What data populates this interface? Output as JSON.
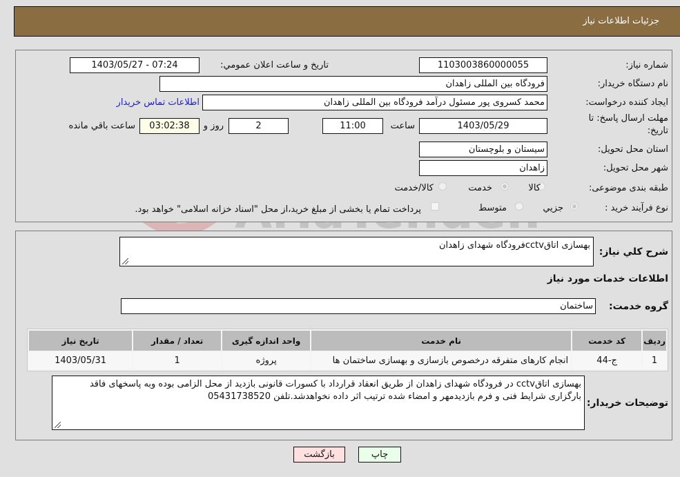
{
  "header": {
    "title": "جزئیات اطلاعات نیاز"
  },
  "info": {
    "need_number_label": "شماره نیاز:",
    "need_number": "1103003860000055",
    "announce_label": "تاريخ و ساعت اعلان عمومي:",
    "announce_value": "1403/05/27 - 07:24",
    "buyer_org_label": "نام دستگاه خریدار:",
    "buyer_org": "فرودگاه بین المللی زاهدان",
    "creator_label": "ایجاد کننده درخواست:",
    "creator": "محمد کسروی پور مسئول درآمد فرودگاه بین المللی زاهدان",
    "contact_link": "اطلاعات تماس خریدار",
    "deadline_label": "مهلت ارسال پاسخ: تا تاریخ:",
    "deadline_date": "1403/05/29",
    "time_label": "ساعت",
    "deadline_time": "11:00",
    "days_value": "2",
    "days_label": "روز و",
    "remaining_time": "03:02:38",
    "remaining_label": "ساعت باقي مانده",
    "province_label": "استان محل تحویل:",
    "province": "سیستان و بلوچستان",
    "city_label": "شهر محل تحویل:",
    "city": "زاهدان",
    "category_label": "طبقه بندی موضوعی:",
    "category_options": [
      {
        "label": "کالا",
        "selected": false
      },
      {
        "label": "خدمت",
        "selected": true
      },
      {
        "label": "کالا/خدمت",
        "selected": false
      }
    ],
    "process_label": "نوع فرآیند خرید :",
    "process_options": [
      {
        "label": "جزيي",
        "selected": true
      },
      {
        "label": "متوسط",
        "selected": false
      }
    ],
    "treasury_checkbox_label": "پرداخت تمام یا بخشی از مبلغ خرید،از محل \"اسناد خزانه اسلامی\" خواهد بود.",
    "treasury_checked": false
  },
  "details": {
    "summary_label": "شرح کلي نياز:",
    "summary": "بهسازی اتاقcctvفرودگاه شهدای زاهدان",
    "services_heading": "اطلاعات خدمات مورد نیاز",
    "service_group_label": "گروه خدمت:",
    "service_group": "ساختمان",
    "table": {
      "headers": [
        "ردیف",
        "کد خدمت",
        "نام خدمت",
        "واحد اندازه گیری",
        "تعداد / مقدار",
        "تاریخ نیاز"
      ],
      "rows": [
        [
          "1",
          "ج-44",
          "انجام کارهای متفرقه درخصوص بازسازی و بهسازی ساختمان ها",
          "پروژه",
          "1",
          "1403/05/31"
        ]
      ]
    },
    "buyer_notes_label": "توضیحات خریدار:",
    "buyer_notes": "بهسازی اتاقcctv در فرودگاه شهدای زاهدان  از طریق انعقاد قرارداد با کسورات قانونی بازدید از محل الزامی بوده وبه پاسخهای فاقد بارگزاری شرایط فنی و فرم بازدیدمهر و امضاء شده ترتیب اثر داده نخواهدشد.تلفن 05431738520"
  },
  "buttons": {
    "print": "چاپ",
    "back": "بازگشت"
  },
  "colors": {
    "header_bg": "#8b6d42",
    "print_bg": "#eaffea",
    "back_bg": "#ffe0e0",
    "link": "#1a1aee"
  }
}
